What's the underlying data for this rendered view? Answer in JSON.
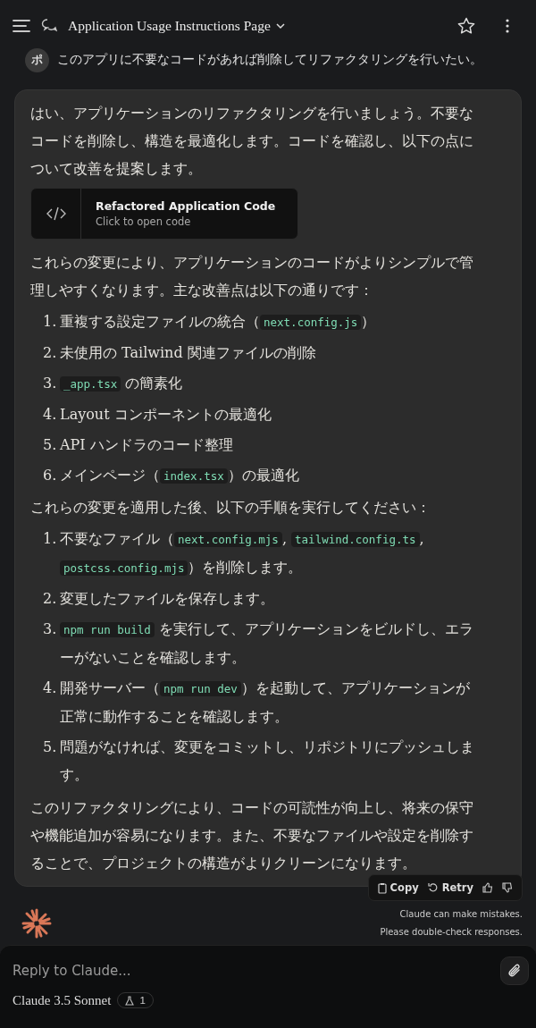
{
  "header": {
    "title": "Application Usage Instructions Page"
  },
  "user_message": {
    "avatar": "ポ",
    "text": "このアプリに不要なコードがあれば削除してリファクタリングを行いたい。"
  },
  "response": {
    "intro": "はい、アプリケーションのリファクタリングを行いましょう。不要なコードを削除し、構造を最適化します。コードを確認し、以下の点について改善を提案します。",
    "artifact": {
      "title": "Refactored Application Code",
      "subtitle": "Click to open code"
    },
    "summary": "これらの変更により、アプリケーションのコードがよりシンプルで管理しやすくなります。主な改善点は以下の通りです：",
    "improvements": [
      {
        "number": "1.",
        "parts": [
          {
            "kind": "text",
            "text": "重複する設定ファイルの統合（"
          },
          {
            "kind": "code",
            "text": "next.config.js"
          },
          {
            "kind": "text",
            "text": "）"
          }
        ]
      },
      {
        "number": "2.",
        "parts": [
          {
            "kind": "text",
            "text": "未使用の Tailwind 関連ファイルの削除"
          }
        ]
      },
      {
        "number": "3.",
        "parts": [
          {
            "kind": "code",
            "text": "_app.tsx"
          },
          {
            "kind": "text",
            "text": " の簡素化"
          }
        ]
      },
      {
        "number": "4.",
        "parts": [
          {
            "kind": "text",
            "text": "Layout コンポーネントの最適化"
          }
        ]
      },
      {
        "number": "5.",
        "parts": [
          {
            "kind": "text",
            "text": "API ハンドラのコード整理"
          }
        ]
      },
      {
        "number": "6.",
        "parts": [
          {
            "kind": "text",
            "text": "メインページ（"
          },
          {
            "kind": "code",
            "text": "index.tsx"
          },
          {
            "kind": "text",
            "text": "）の最適化"
          }
        ]
      }
    ],
    "steps_intro": "これらの変更を適用した後、以下の手順を実行してください：",
    "steps": [
      {
        "number": "1.",
        "parts": [
          {
            "kind": "text",
            "text": "不要なファイル（"
          },
          {
            "kind": "code",
            "text": "next.config.mjs"
          },
          {
            "kind": "text",
            "text": ", "
          },
          {
            "kind": "code",
            "text": "tailwind.config.ts"
          },
          {
            "kind": "text",
            "text": ", "
          },
          {
            "kind": "code",
            "text": "postcss.config.mjs"
          },
          {
            "kind": "text",
            "text": "）を削除します。"
          }
        ]
      },
      {
        "number": "2.",
        "parts": [
          {
            "kind": "text",
            "text": "変更したファイルを保存します。"
          }
        ]
      },
      {
        "number": "3.",
        "parts": [
          {
            "kind": "code",
            "text": "npm run build"
          },
          {
            "kind": "text",
            "text": " を実行して、アプリケーションをビルドし、エラーがないことを確認します。"
          }
        ]
      },
      {
        "number": "4.",
        "parts": [
          {
            "kind": "text",
            "text": "開発サーバー（"
          },
          {
            "kind": "code",
            "text": "npm run dev"
          },
          {
            "kind": "text",
            "text": "）を起動して、アプリケーションが正常に動作することを確認します。"
          }
        ]
      },
      {
        "number": "5.",
        "parts": [
          {
            "kind": "text",
            "text": "問題がなければ、変更をコミットし、リポジトリにプッシュします。"
          }
        ]
      }
    ],
    "conclusion": "このリファクタリングにより、コードの可読性が向上し、将来の保守や機能追加が容易になります。また、不要なファイルや設定を削除することで、プロジェクトの構造がよりクリーンになります。"
  },
  "actions": {
    "copy": "Copy",
    "retry": "Retry"
  },
  "disclaimer": [
    "Claude can make mistakes.",
    "Please double-check responses."
  ],
  "composer": {
    "placeholder": "Reply to Claude...",
    "model": "Claude 3.5 Sonnet",
    "badge_count": "1"
  }
}
